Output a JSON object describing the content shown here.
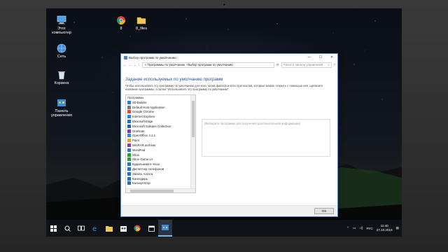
{
  "desktop": {
    "icons": [
      {
        "label": "Этот компьютер"
      },
      {
        "label": "Сеть"
      },
      {
        "label": "Корзина"
      },
      {
        "label": "Панель управления"
      },
      {
        "label": "8"
      },
      {
        "label": "8_files"
      }
    ]
  },
  "window": {
    "title": "Выбор программ по умолчанию",
    "controls": {
      "minimize": "—",
      "maximize": "☐",
      "close": "✕"
    },
    "address": {
      "back": "←",
      "forward": "→",
      "down": "⌄",
      "up": "↑",
      "path": "« Программы по умолчанию › Выбор программ по умолчанию",
      "refresh": "⟳",
      "search_placeholder": "Поиск в панели управления",
      "help": "?"
    },
    "heading": "Задание используемых по умолчанию программ",
    "description": "Чтобы использовать эту программу по умолчанию для всех типов файлов и всех протоколов, которые можно открыть с помощью неё, щелкните название программы, а затем \"Использовать эту программу по умолчанию\".",
    "list_header": "Программы",
    "programs": [
      {
        "name": "3D Builder",
        "color": "#3a7bd5"
      },
      {
        "name": "Default Host Application",
        "color": "#7a7a7a"
      },
      {
        "name": "Google Chrome",
        "color": "#e04a3a"
      },
      {
        "name": "Internet Explorer",
        "color": "#2b86d8"
      },
      {
        "name": "Microsoft Edge",
        "color": "#1f6fd0"
      },
      {
        "name": "Microsoft Solitaire Collection",
        "color": "#2a5fb0"
      },
      {
        "name": "OneNote",
        "color": "#7a3fa8"
      },
      {
        "name": "OpenOffice 4.1.1",
        "color": "#2e8fd0"
      },
      {
        "name": "Paint",
        "color": "#e0a530"
      },
      {
        "name": "WinRAR archiver",
        "color": "#8a3d9a"
      },
      {
        "name": "WordPad",
        "color": "#3a76c4"
      },
      {
        "name": "Xbox",
        "color": "#2e9a3a"
      },
      {
        "name": "Xbox Game UI",
        "color": "#2e9a3a"
      },
      {
        "name": "Будильники и часы",
        "color": "#2a6fc0"
      },
      {
        "name": "Диспетчер телефонов",
        "color": "#2a6fc0"
      },
      {
        "name": "Запись голоса",
        "color": "#2a6fc0"
      },
      {
        "name": "Календарь",
        "color": "#2a6fc0"
      },
      {
        "name": "Калькулятор",
        "color": "#2a6fc0"
      }
    ],
    "info_placeholder": "(Выберите программу для получения дополнительной информации)",
    "ok_label": "ОК"
  },
  "taskbar": {
    "items": [
      "start",
      "search",
      "task-view",
      "edge",
      "explorer",
      "store",
      "chrome",
      "calendar",
      "control-panel"
    ],
    "language": "РУС",
    "time": "11:40",
    "date": "27.10.2015"
  }
}
